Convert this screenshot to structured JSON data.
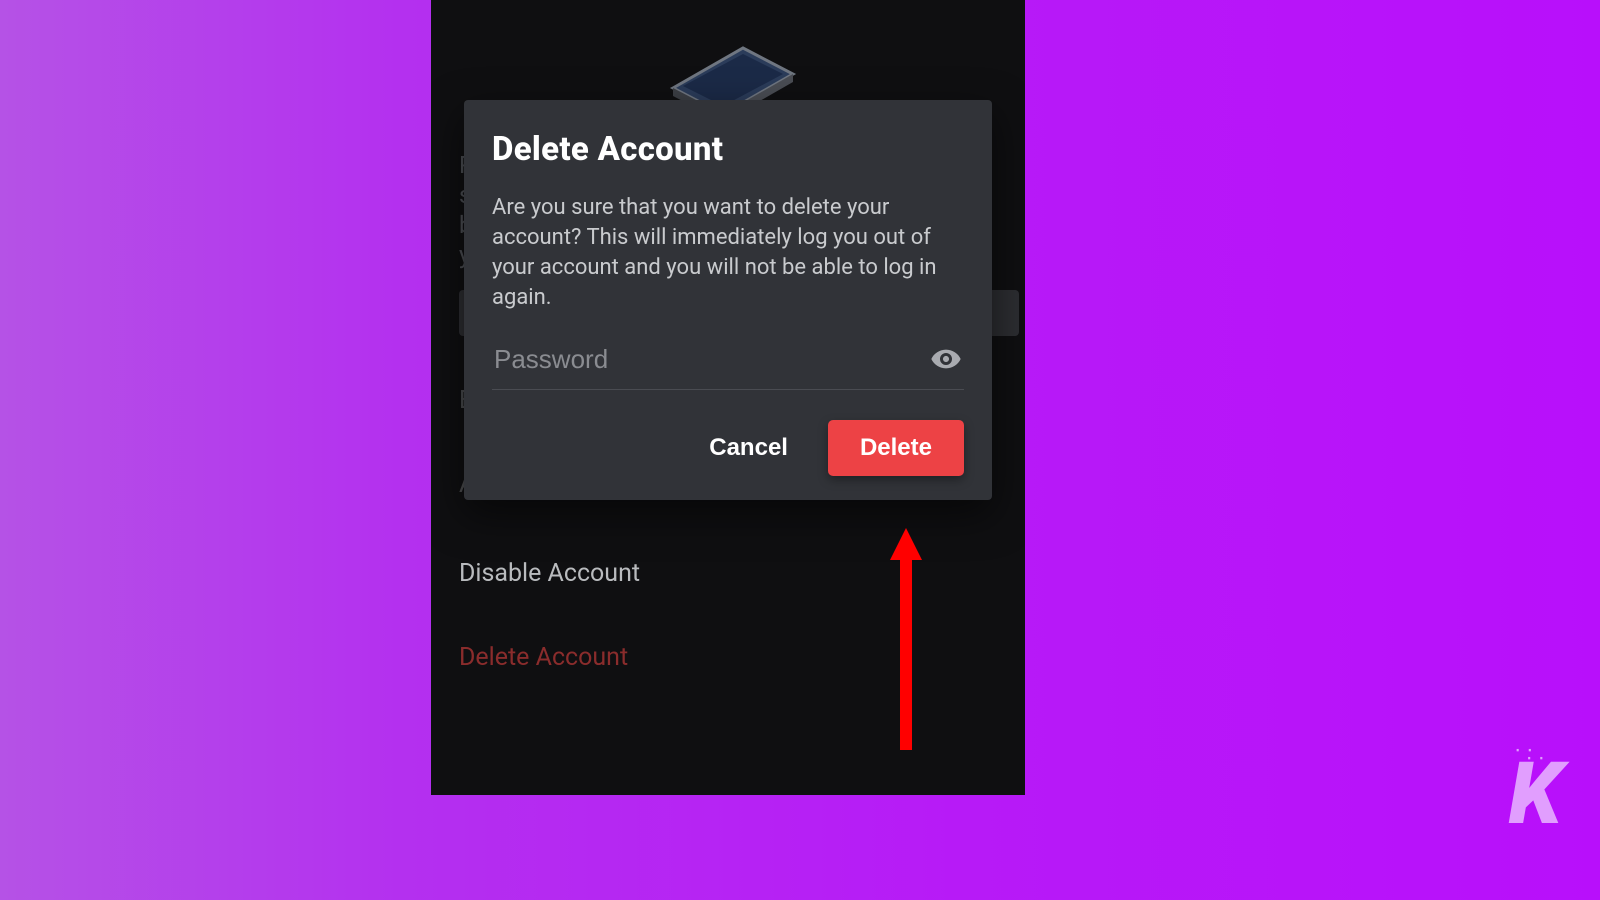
{
  "modal": {
    "title": "Delete Account",
    "body": "Are you sure that you want to delete your account? This will immediately log you out of your account and you will not be able to log in again.",
    "password_placeholder": "Password",
    "password_value": "",
    "cancel_label": "Cancel",
    "delete_label": "Delete"
  },
  "background": {
    "partial_text_1": "P",
    "partial_text_2": "s",
    "partial_text_3": "b",
    "partial_text_4": "y",
    "row_e": "E",
    "row_a": "A",
    "disable_label": "Disable Account",
    "delete_label": "Delete Account"
  },
  "watermark": {
    "glyph": "K"
  },
  "colors": {
    "accent_red": "#ed4245",
    "modal_bg": "#313338",
    "phone_bg": "#0f0f11"
  }
}
